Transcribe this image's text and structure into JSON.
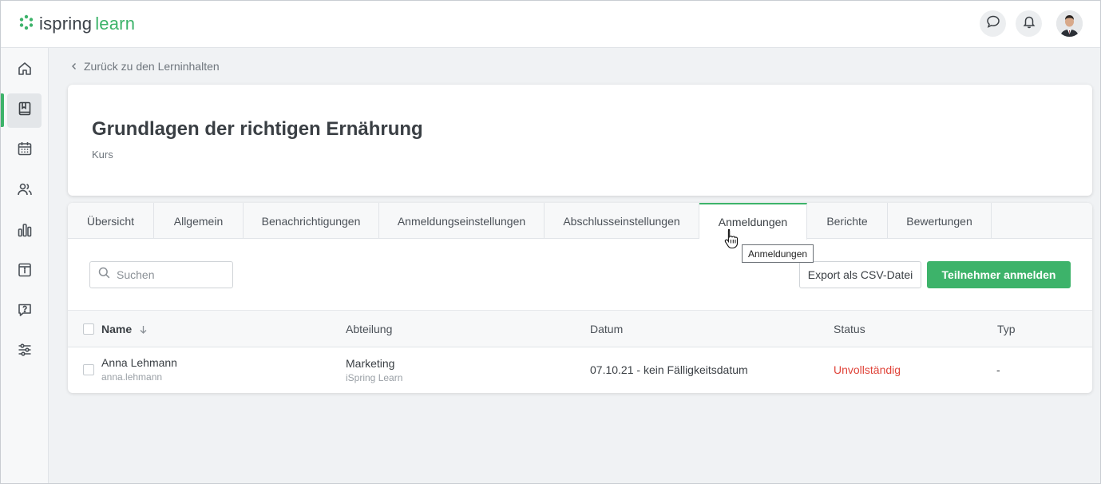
{
  "app": {
    "logo_word_1": "ispring",
    "logo_word_2": "learn",
    "brand_color": "#3db36a"
  },
  "topbar": {
    "icons": [
      "chat-icon",
      "bell-icon",
      "avatar"
    ]
  },
  "sidebar": {
    "items": [
      {
        "icon": "home-icon",
        "active": false
      },
      {
        "icon": "book-icon",
        "active": true
      },
      {
        "icon": "calendar-icon",
        "active": false
      },
      {
        "icon": "users-icon",
        "active": false
      },
      {
        "icon": "bar-chart-icon",
        "active": false
      },
      {
        "icon": "info-box-icon",
        "active": false
      },
      {
        "icon": "question-chat-icon",
        "active": false
      },
      {
        "icon": "sliders-icon",
        "active": false
      }
    ]
  },
  "breadcrumb": {
    "back_label": "Zurück zu den Lerninhalten"
  },
  "course": {
    "title": "Grundlagen der richtigen Ernährung",
    "type": "Kurs"
  },
  "tabs": [
    {
      "label": "Übersicht",
      "active": false
    },
    {
      "label": "Allgemein",
      "active": false
    },
    {
      "label": "Benachrichtigungen",
      "active": false
    },
    {
      "label": "Anmeldungseinstellungen",
      "active": false
    },
    {
      "label": "Abschlusseinstellungen",
      "active": false
    },
    {
      "label": "Anmeldungen",
      "active": true
    },
    {
      "label": "Berichte",
      "active": false
    },
    {
      "label": "Bewertungen",
      "active": false
    }
  ],
  "tooltip": {
    "text": "Anmeldungen"
  },
  "toolbar": {
    "search_placeholder": "Suchen",
    "export_label": "Export als CSV-Datei",
    "enroll_label": "Teilnehmer anmelden"
  },
  "table": {
    "columns": [
      "Name",
      "Abteilung",
      "Datum",
      "Status",
      "Typ"
    ],
    "sort_column": "Name",
    "rows": [
      {
        "name": "Anna Lehmann",
        "username": "anna.lehmann",
        "department": "Marketing",
        "organization": "iSpring Learn",
        "date": "07.10.21 - kein Fälligkeitsdatum",
        "status": "Unvollständig",
        "status_color": "#e0443a",
        "type": "-"
      }
    ]
  }
}
